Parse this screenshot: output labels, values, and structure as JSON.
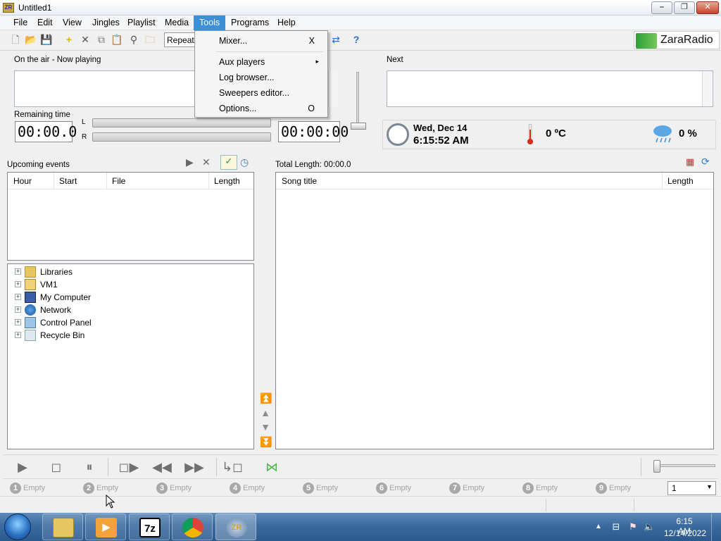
{
  "window": {
    "title": "Untitled1",
    "app_icon_text": "ZR"
  },
  "menubar": [
    "File",
    "Edit",
    "View",
    "Jingles",
    "Playlist",
    "Media",
    "Tools",
    "Programs",
    "Help"
  ],
  "toolbar": {
    "repeat_label": "Repeat",
    "logo_text": "ZaraRadio"
  },
  "tools_menu": {
    "items": [
      {
        "label": "Mixer...",
        "shortcut": "X"
      },
      {
        "label": "Aux players",
        "submenu": "▸"
      },
      {
        "label": "Log browser..."
      },
      {
        "label": "Sweepers editor..."
      },
      {
        "label": "Options...",
        "shortcut": "O"
      }
    ]
  },
  "on_air": {
    "label": "On the air - Now playing",
    "remaining_label": "Remaining time",
    "remaining_value": "00:00.0",
    "meter_left": "L",
    "meter_right": "R",
    "end_time": "00:00:00"
  },
  "next": {
    "label": "Next"
  },
  "info": {
    "date": "Wed, Dec 14",
    "time": "6:15:52 AM",
    "temperature": "0 ºC",
    "rain": "0 %"
  },
  "events": {
    "label": "Upcoming events",
    "columns": [
      "Hour",
      "Start",
      "File",
      "Length"
    ]
  },
  "tree": {
    "items": [
      "Libraries",
      "VM1",
      "My Computer",
      "Network",
      "Control Panel",
      "Recycle Bin"
    ]
  },
  "playlist": {
    "total_length": "Total Length: 00:00.0",
    "columns": [
      "Song title",
      "Length"
    ]
  },
  "slots": {
    "items": [
      {
        "num": "1",
        "text": "Empty"
      },
      {
        "num": "2",
        "text": "Empty"
      },
      {
        "num": "3",
        "text": "Empty"
      },
      {
        "num": "4",
        "text": "Empty"
      },
      {
        "num": "5",
        "text": "Empty"
      },
      {
        "num": "6",
        "text": "Empty"
      },
      {
        "num": "7",
        "text": "Empty"
      },
      {
        "num": "8",
        "text": "Empty"
      },
      {
        "num": "9",
        "text": "Empty"
      }
    ],
    "page_select": "1"
  },
  "taskbar": {
    "apps": [
      {
        "name": "explorer",
        "glyph": ""
      },
      {
        "name": "media-player",
        "glyph": "▶"
      },
      {
        "name": "7zip",
        "glyph": "7z"
      },
      {
        "name": "chrome",
        "glyph": ""
      },
      {
        "name": "zararadio",
        "glyph": "ZR"
      }
    ],
    "clock_time": "6:15 AM",
    "clock_date": "12/14/2022"
  },
  "colors": {
    "menu_highlight": "#3c8fd9",
    "taskbar": "#3a6a9e",
    "logo_green": "#2e9e3a"
  }
}
